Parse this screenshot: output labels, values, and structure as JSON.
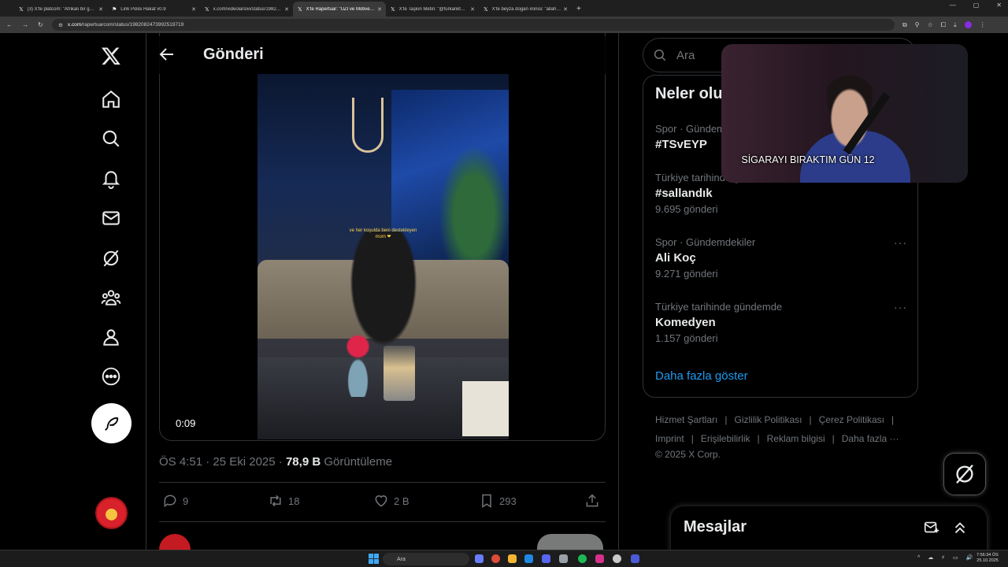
{
  "browser": {
    "tabs": [
      {
        "title": "(3) X'te platcom: \"Afrikalı bir g…",
        "active": false
      },
      {
        "title": "Link Polisi Hakat v0.9",
        "active": false
      },
      {
        "title": "x.com/videolarsivi/status/1982…",
        "active": false
      },
      {
        "title": "X'te Rapertuar: \"UZİ ve Motive…",
        "active": true
      },
      {
        "title": "X'te Taşkın Metin: \"@furkankt…",
        "active": false
      },
      {
        "title": "X'te beyza dogan ironisi: \"allah…",
        "active": false
      }
    ],
    "new_tab": "+",
    "url_domain": "x.com",
    "url_path": "/rapertuarcom/status/1982082473992519719"
  },
  "page": {
    "title": "Gönderi"
  },
  "post": {
    "video_caption_line1": "ve her koşulda beni destekleyen",
    "video_caption_line2": "mom ❤",
    "video_time": "0:09",
    "time": "ÖS 4:51",
    "date": "25 Eki 2025",
    "views_count": "78,9 B",
    "views_label": "Görüntüleme",
    "replies": "9",
    "reposts": "18",
    "likes": "2 B",
    "bookmarks": "293"
  },
  "sidebar": {
    "search_placeholder": "Ara",
    "trends_title": "Neler oluyor",
    "trends": [
      {
        "context": "Spor · Gündemdekiler",
        "name": "#TSvEYP",
        "count": ""
      },
      {
        "context": "Türkiye tarihinde gündemde",
        "name": "#sallandık",
        "count": "9.695 gönderi"
      },
      {
        "context": "Spor · Gündemdekiler",
        "name": "Ali Koç",
        "count": "9.271 gönderi"
      },
      {
        "context": "Türkiye tarihinde gündemde",
        "name": "Komedyen",
        "count": "1.157 gönderi"
      }
    ],
    "show_more": "Daha fazla göster",
    "footer": [
      "Hizmet Şartları",
      "Gizlilik Politikası",
      "Çerez Politikası",
      "Imprint",
      "Erişilebilirlik",
      "Reklam bilgisi",
      "Daha fazla ···"
    ],
    "copyright": "© 2025 X Corp."
  },
  "webcam": {
    "overlay_text": "SİGARAYI BIRAKTIM GÜN 12"
  },
  "messages": {
    "title": "Mesajlar"
  },
  "taskbar": {
    "search_label": "Ara",
    "time": "7:56:34 ÖS",
    "date": "25.10.2025"
  },
  "colors": {
    "accent": "#1d9bf0",
    "text_primary": "#e7e9ea",
    "text_secondary": "#71767b",
    "border": "#2f3336",
    "background": "#000000"
  }
}
